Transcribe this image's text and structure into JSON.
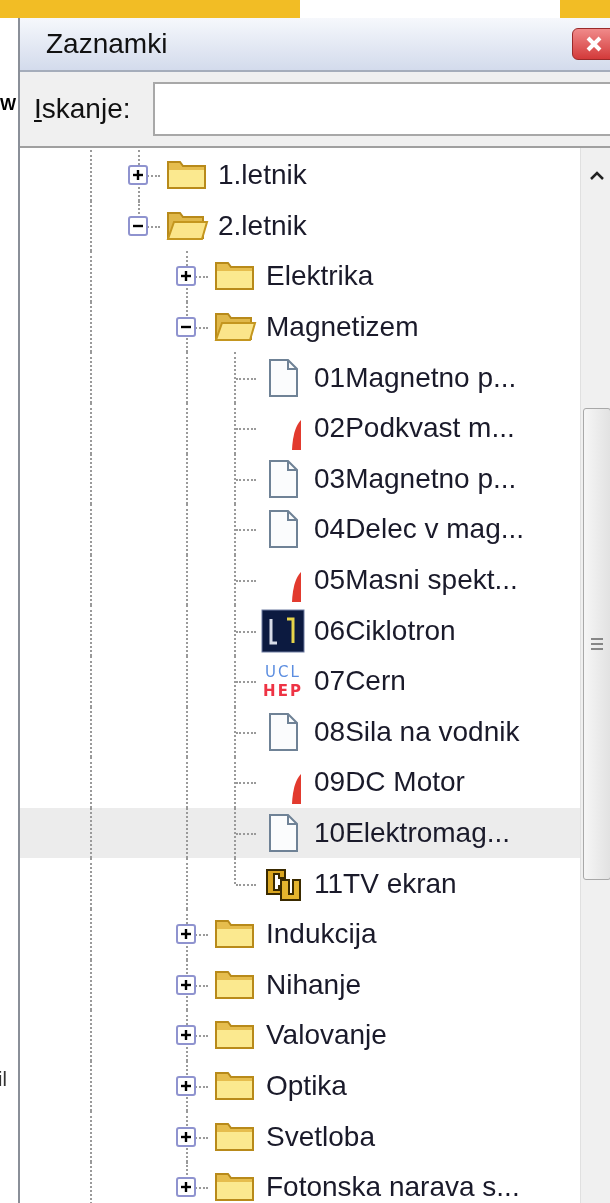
{
  "page_behind": {
    "heading_fragment": "W",
    "text_fragment": "il"
  },
  "panel": {
    "title": "Zaznamki",
    "search": {
      "label": "Iskanje:"
    }
  },
  "tree": [
    {
      "label": "1.letnik",
      "kind": "folder",
      "expanded": false,
      "hovered": false
    },
    {
      "label": "2.letnik",
      "kind": "folder",
      "expanded": true,
      "hovered": false,
      "children": [
        {
          "label": "Elektrika",
          "kind": "folder",
          "expanded": false,
          "hovered": false
        },
        {
          "label": "Magnetizem",
          "kind": "folder",
          "expanded": true,
          "hovered": false,
          "children": [
            {
              "label": "01Magnetno p...",
              "kind": "page",
              "hovered": false
            },
            {
              "label": "02Podkvast m...",
              "kind": "wedge",
              "hovered": false
            },
            {
              "label": "03Magnetno p...",
              "kind": "page",
              "hovered": false
            },
            {
              "label": "04Delec v mag...",
              "kind": "page",
              "hovered": false
            },
            {
              "label": "05Masni spekt...",
              "kind": "wedge",
              "hovered": false
            },
            {
              "label": "06Ciklotron",
              "kind": "dark-square",
              "hovered": false
            },
            {
              "label": "07Cern",
              "kind": "logo",
              "logo_lines": [
                "UCL",
                "HEP"
              ],
              "hovered": false
            },
            {
              "label": "08Sila na vodnik",
              "kind": "page",
              "hovered": false
            },
            {
              "label": "09DC Motor",
              "kind": "wedge",
              "hovered": false
            },
            {
              "label": "10Elektromag...",
              "kind": "page",
              "hovered": true
            },
            {
              "label": "11TV ekran",
              "kind": "emblem",
              "hovered": false
            }
          ]
        },
        {
          "label": "Indukcija",
          "kind": "folder",
          "expanded": false,
          "hovered": false
        },
        {
          "label": "Nihanje",
          "kind": "folder",
          "expanded": false,
          "hovered": false
        },
        {
          "label": "Valovanje",
          "kind": "folder",
          "expanded": false,
          "hovered": false
        },
        {
          "label": "Optika",
          "kind": "folder",
          "expanded": false,
          "hovered": false
        },
        {
          "label": "Svetloba",
          "kind": "folder",
          "expanded": false,
          "hovered": false
        },
        {
          "label": "Fotonska narava s...",
          "kind": "folder",
          "expanded": false,
          "hovered": false
        }
      ]
    }
  ]
}
